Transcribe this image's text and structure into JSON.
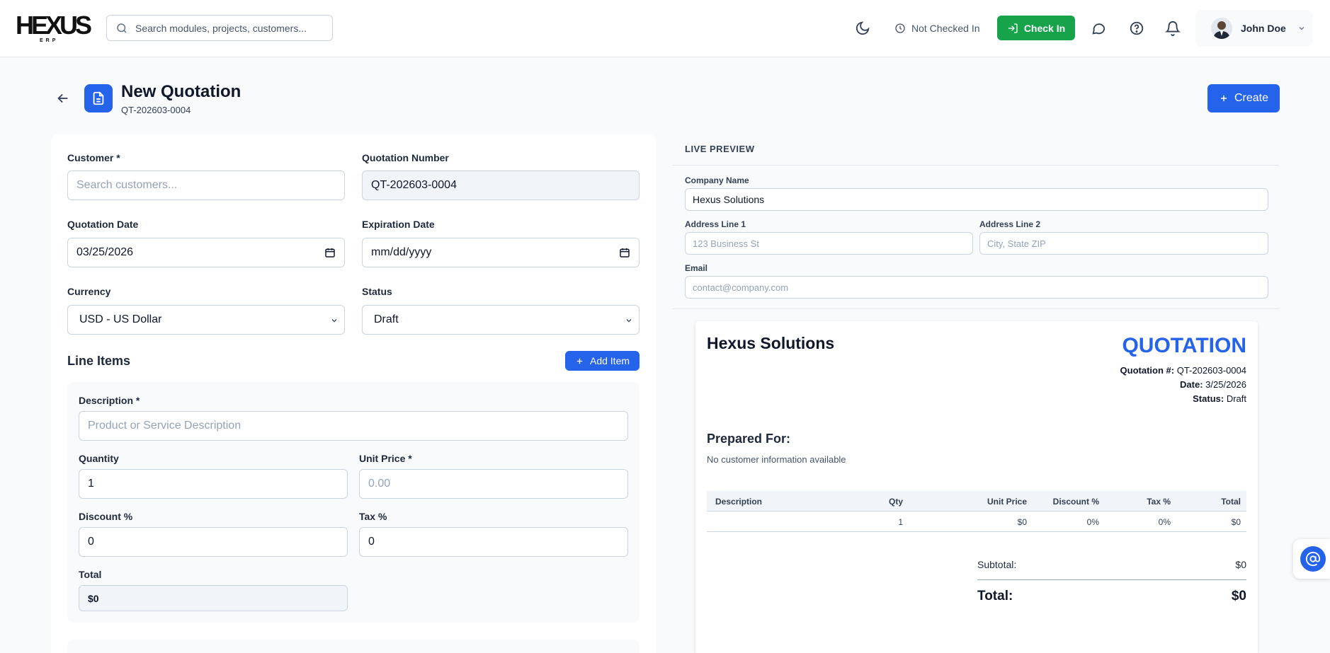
{
  "colors": {
    "primary": "#2563eb",
    "success": "#16a34a",
    "text": "#0f172a"
  },
  "topbar": {
    "logo_text": "HEXUS",
    "logo_sub": "ERP",
    "search_placeholder": "Search modules, projects, customers...",
    "check_status": "Not Checked In",
    "check_in_label": "Check In",
    "user_name": "John Doe",
    "icons": [
      "moon-icon",
      "clock-icon",
      "login-icon",
      "chat-icon",
      "help-icon",
      "bell-icon",
      "chevron-down-icon"
    ]
  },
  "page": {
    "title": "New Quotation",
    "subtitle": "QT-202603-0004",
    "create_label": "Create"
  },
  "form": {
    "customer": {
      "label": "Customer *",
      "placeholder": "Search customers..."
    },
    "quotation_number": {
      "label": "Quotation Number",
      "value": "QT-202603-0004"
    },
    "quotation_date": {
      "label": "Quotation Date",
      "value": "03/25/2026"
    },
    "expiration_date": {
      "label": "Expiration Date",
      "value": "mm/dd/yyyy"
    },
    "currency": {
      "label": "Currency",
      "value": "USD - US Dollar"
    },
    "status": {
      "label": "Status",
      "value": "Draft"
    },
    "line_items_title": "Line Items",
    "add_item_label": "Add Item",
    "item": {
      "description": {
        "label": "Description *",
        "placeholder": "Product or Service Description"
      },
      "quantity": {
        "label": "Quantity",
        "value": "1"
      },
      "unit_price": {
        "label": "Unit Price *",
        "placeholder": "0.00"
      },
      "discount": {
        "label": "Discount %",
        "value": "0"
      },
      "tax": {
        "label": "Tax %",
        "value": "0"
      },
      "total": {
        "label": "Total",
        "value": "$0"
      }
    }
  },
  "preview": {
    "heading": "LIVE PREVIEW",
    "company_name": {
      "label": "Company Name",
      "value": "Hexus Solutions"
    },
    "address1": {
      "label": "Address Line 1",
      "placeholder": "123 Business St"
    },
    "address2": {
      "label": "Address Line 2",
      "placeholder": "City, State ZIP"
    },
    "email": {
      "label": "Email",
      "placeholder": "contact@company.com"
    },
    "doc": {
      "company": "Hexus Solutions",
      "title": "QUOTATION",
      "quote_no_label": "Quotation #:",
      "quote_no": "QT-202603-0004",
      "date_label": "Date:",
      "date": "3/25/2026",
      "status_label": "Status:",
      "status": "Draft",
      "prepared_for": "Prepared For:",
      "no_customer": "No customer information available",
      "table_headers": [
        "Description",
        "Qty",
        "Unit Price",
        "Discount %",
        "Tax %",
        "Total"
      ],
      "table_row": [
        "",
        "1",
        "$0",
        "0%",
        "0%",
        "$0"
      ],
      "subtotal_label": "Subtotal:",
      "subtotal": "$0",
      "total_label": "Total:",
      "total": "$0"
    }
  }
}
